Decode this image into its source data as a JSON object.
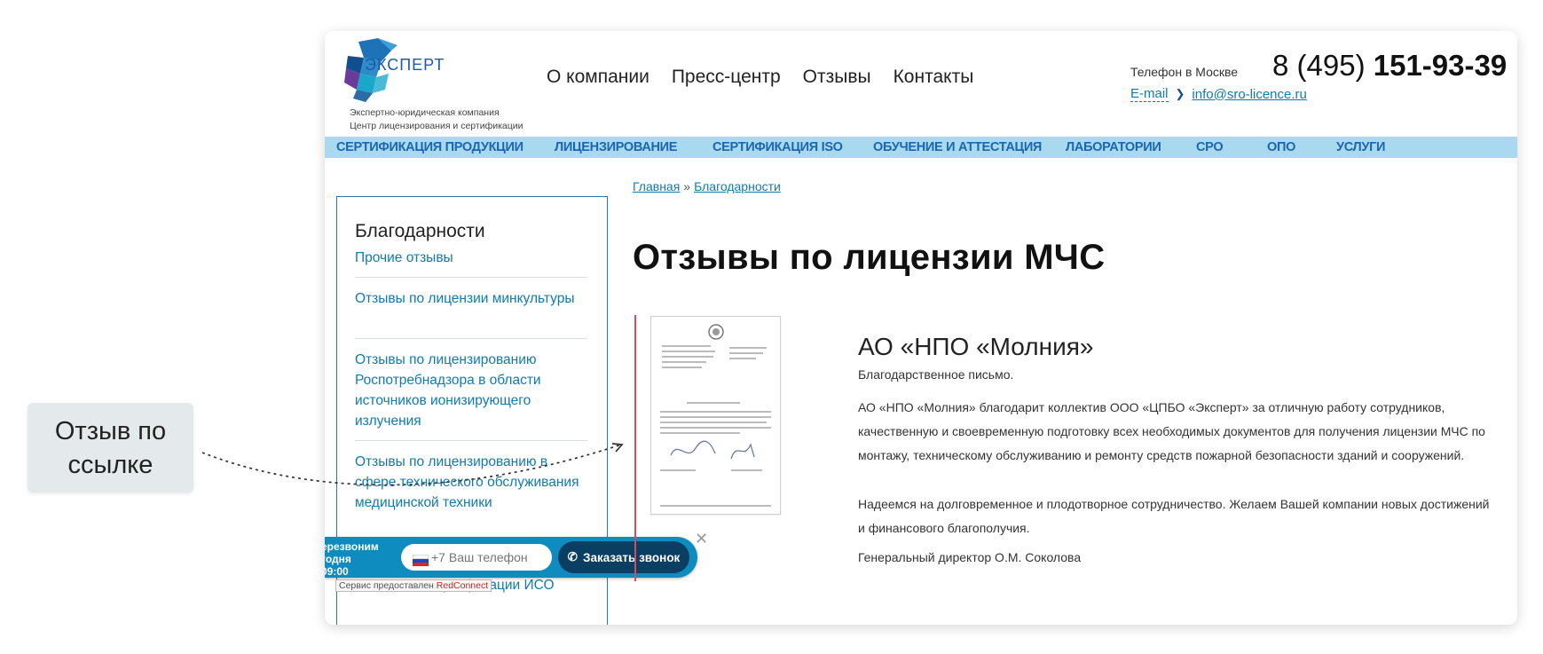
{
  "callout": {
    "text_line1": "Отзыв по",
    "text_line2": "ссылке"
  },
  "header": {
    "logo_text": "ЭКСПЕРТ",
    "tagline_line1": "Экспертно-юридическая компания",
    "tagline_line2": "Центр лицензирования и сертификации",
    "top_nav": [
      "О компании",
      "Пресс-центр",
      "Отзывы",
      "Контакты"
    ],
    "phone_label": "Телефон в Москве",
    "phone_prefix": "8 (495)",
    "phone_number": "151-93-39",
    "email_label": "E-mail",
    "email_address": "info@sro-licence.ru"
  },
  "main_nav": [
    "СЕРТИФИКАЦИЯ ПРОДУКЦИИ",
    "ЛИЦЕНЗИРОВАНИЕ",
    "СЕРТИФИКАЦИЯ ISO",
    "ОБУЧЕНИЕ И АТТЕСТАЦИЯ",
    "ЛАБОРАТОРИИ",
    "СРО",
    "ОПО",
    "УСЛУГИ"
  ],
  "sidebar": {
    "title": "Благодарности",
    "items": [
      "Прочие отзывы",
      "Отзывы по лицензии минкультуры",
      "Отзывы по лицензированию Роспотребнадзора в области источников ионизирующего излучения",
      "Отзывы по лицензированию в сфере технического обслуживания медицинской техники",
      "Отзывы по сертификации ИСО"
    ]
  },
  "callback": {
    "text_line1": "ерезвоним",
    "text_line2": "годня",
    "text_line3": "09:00",
    "placeholder": "+7 Ваш телефон",
    "button_label": "Заказать звонок",
    "credit_prefix": "Сервис предоставлен",
    "credit_brand": "RedConnect"
  },
  "breadcrumb": {
    "home": "Главная",
    "separator": "»",
    "current": "Благодарности"
  },
  "page_title": "Отзывы по лицензии МЧС",
  "review": {
    "company": "АО «НПО «Молния»",
    "p1": "Благодарственное письмо.",
    "p2": "АО «НПО «Молния» благодарит коллектив ООО «ЦПБО «Эксперт» за отличную работу сотрудников, качественную и своевременную подготовку всех необходимых документов для получения лицензии МЧС по монтажу, техническому обслуживанию и ремонту средств пожарной безопасности зданий и сооружений.",
    "p3": "Надеемся на долговременное и плодотворное сотрудничество. Желаем Вашей компании новых достижений и финансового благополучия.",
    "p4": "Генеральный директор О.М. Соколова"
  },
  "colors": {
    "brand_blue": "#0f7bb0",
    "nav_band": "#a9d9ee",
    "nav_text": "#1b66b1",
    "accent_red": "#d8495d",
    "widget_blue": "#0e8cbf",
    "widget_button": "#0a3f63"
  }
}
